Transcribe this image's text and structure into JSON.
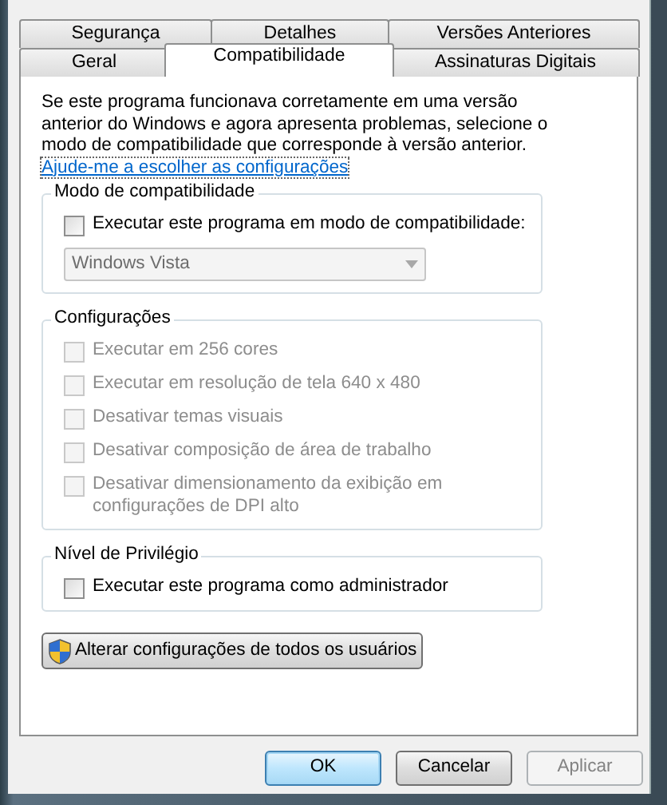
{
  "tab_rows": [
    [
      {
        "label": "Segurança",
        "selected": false
      },
      {
        "label": "Detalhes",
        "selected": false
      },
      {
        "label": "Versões Anteriores",
        "selected": false
      }
    ],
    [
      {
        "label": "Geral",
        "selected": false
      },
      {
        "label": "Compatibilidade",
        "selected": true
      },
      {
        "label": "Assinaturas Digitais",
        "selected": false
      }
    ]
  ],
  "intro": "Se este programa funcionava corretamente em uma versão anterior do Windows e agora apresenta problemas, selecione o modo de compatibilidade que corresponde à versão anterior.",
  "help_link": "Ajude-me a escolher as configurações",
  "groups": [
    {
      "title": "Modo de compatibilidade",
      "items": [
        {
          "kind": "checkbox",
          "label": "Executar este programa em modo de compatibilidade:",
          "checked": false,
          "disabled": false
        },
        {
          "kind": "dropdown",
          "value": "Windows Vista",
          "disabled": true
        }
      ]
    },
    {
      "title": "Configurações",
      "items": [
        {
          "kind": "checkbox",
          "label": "Executar em 256 cores",
          "checked": false,
          "disabled": true
        },
        {
          "kind": "checkbox",
          "label": "Executar em resolução de tela 640 x 480",
          "checked": false,
          "disabled": true
        },
        {
          "kind": "checkbox",
          "label": "Desativar temas visuais",
          "checked": false,
          "disabled": true
        },
        {
          "kind": "checkbox",
          "label": "Desativar composição de área de trabalho",
          "checked": false,
          "disabled": true
        },
        {
          "kind": "checkbox",
          "label": "Desativar dimensionamento da exibição em configurações de DPI alto",
          "checked": false,
          "disabled": true
        }
      ]
    },
    {
      "title": "Nível de Privilégio",
      "items": [
        {
          "kind": "checkbox",
          "label": "Executar este programa como administrador",
          "checked": false,
          "disabled": false
        }
      ]
    }
  ],
  "admin_button": "Alterar configurações de todos os usuários",
  "buttons": [
    {
      "label": "OK",
      "default": true,
      "disabled": false
    },
    {
      "label": "Cancelar",
      "default": false,
      "disabled": false
    },
    {
      "label": "Aplicar",
      "default": false,
      "disabled": true
    }
  ]
}
